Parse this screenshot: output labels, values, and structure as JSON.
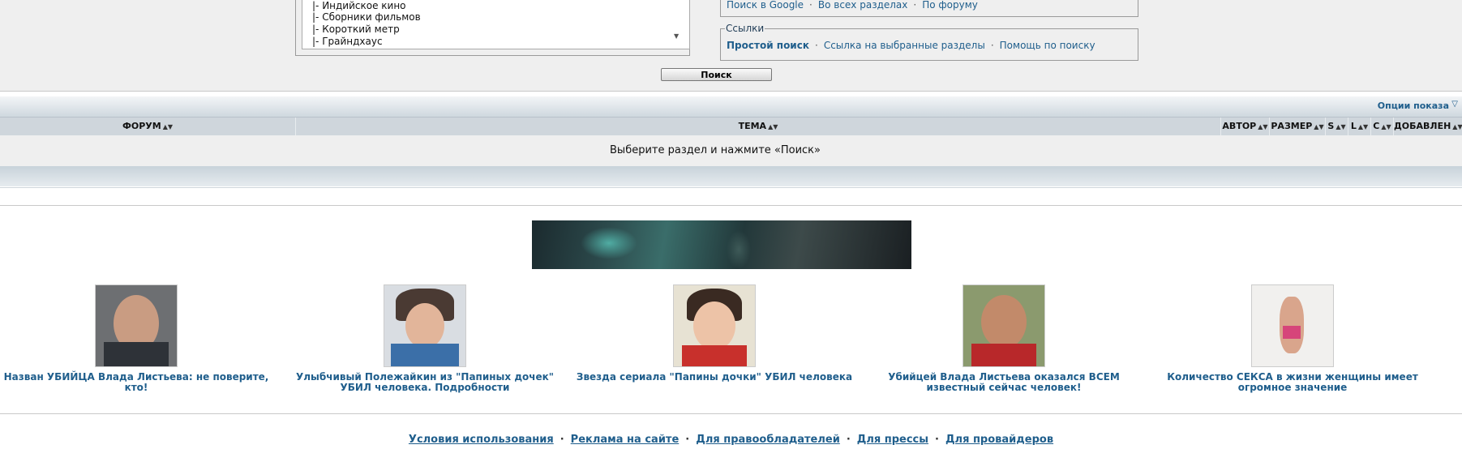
{
  "forum_list": {
    "items": [
      "|- Индийское кино",
      "|- Сборники фильмов",
      "|- Короткий метр",
      "|- Грайндхаус"
    ]
  },
  "google": {
    "links": [
      "Поиск в Google",
      "Во всех разделах",
      "По форуму"
    ]
  },
  "links_box": {
    "legend": "Ссылки",
    "items": [
      "Простой поиск",
      "Ссылка на выбранные разделы",
      "Помощь по поиску"
    ]
  },
  "search_button": "Поиск",
  "options": {
    "label": "Опции показа",
    "icon": "chevron-down-icon"
  },
  "table": {
    "columns": [
      "ФОРУМ",
      "ТЕМА",
      "АВТОР",
      "РАЗМЕР",
      "S",
      "L",
      "C",
      "ДОБАВЛЕН"
    ],
    "empty_message": "Выберите раздел и нажмите «Поиск»"
  },
  "promo": {
    "cards": [
      {
        "title": "Назван УБИЙЦА Влада Листьева: не поверите, кто!"
      },
      {
        "title": "Улыбчивый Полежайкин из \"Папиных дочек\" УБИЛ человека. Подробности"
      },
      {
        "title": "Звезда сериала \"Папины дочки\" УБИЛ человека"
      },
      {
        "title": "Убийцей Влада Листьева оказался ВСЕМ известный сейчас человек!"
      },
      {
        "title": "Количество СЕКСА в жизни женщины имеет огромное значение"
      }
    ]
  },
  "footer": {
    "links": [
      "Условия использования",
      "Реклама на сайте",
      "Для правообладателей",
      "Для прессы",
      "Для провайдеров"
    ]
  },
  "colors": {
    "link": "#1f5e8c",
    "background": "#efefef",
    "header": "#cfd6dc"
  }
}
